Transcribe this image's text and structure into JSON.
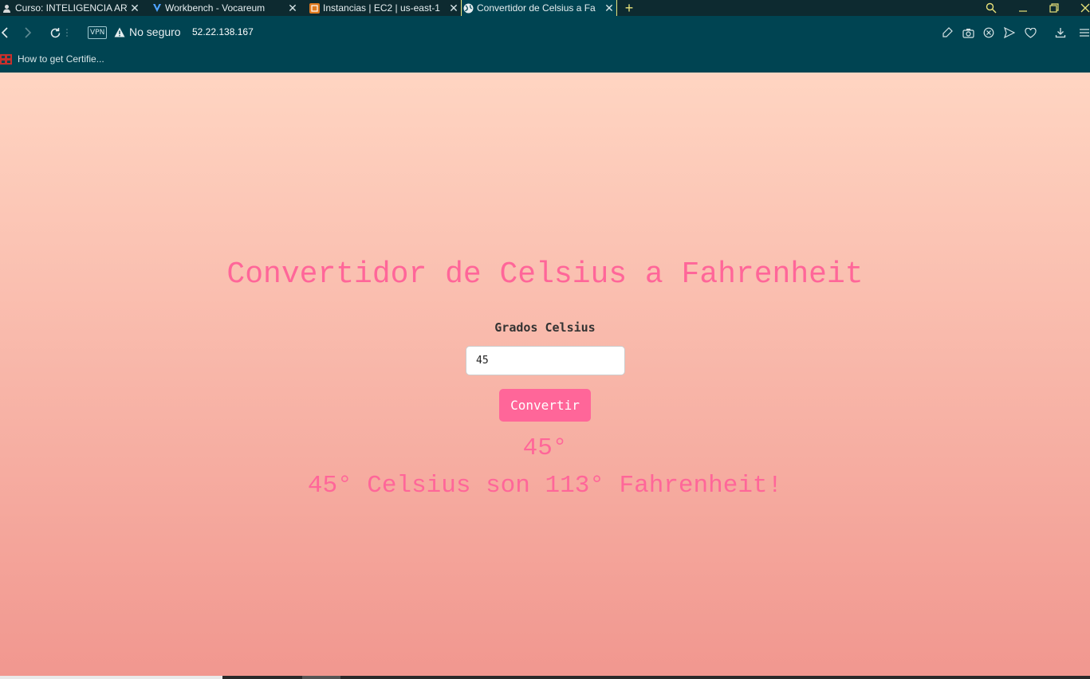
{
  "tabs": [
    {
      "title": "Curso: INTELIGENCIA ARTIFI",
      "icon": "user-favicon",
      "active": false
    },
    {
      "title": "Workbench - Vocareum",
      "icon": "vocareum-favicon",
      "active": false
    },
    {
      "title": "Instancias | EC2 | us-east-1",
      "icon": "aws-favicon",
      "active": false
    },
    {
      "title": "Convertidor de Celsius a Fa",
      "icon": "globe-favicon",
      "active": true
    }
  ],
  "addressbar": {
    "vpn": "VPN",
    "security": "No seguro",
    "url": "52.22.138.167"
  },
  "bookmarks": [
    {
      "label": "How to get Certifie..."
    }
  ],
  "page": {
    "heading": "Convertidor de Celsius a Fahrenheit",
    "label": "Grados Celsius",
    "input_value": "45",
    "button": "Convertir",
    "celsius_output": "45°",
    "result": "45° Celsius son 113° Fahrenheit!"
  },
  "colors": {
    "accent": "#ff6699",
    "gradient_top": "#ffd5c2",
    "gradient_bottom": "#f1978f",
    "browser_bar": "#004452",
    "active_tab_border": "#e8e27a"
  }
}
